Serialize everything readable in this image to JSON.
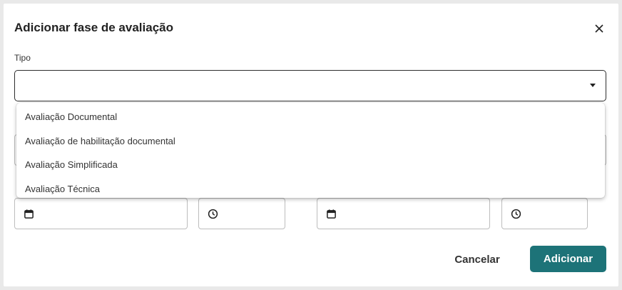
{
  "dialog": {
    "title": "Adicionar fase de avaliação",
    "close_icon": "close-icon"
  },
  "form": {
    "tipo_label": "Tipo",
    "tipo_value": "",
    "tipo_options": [
      "Avaliação Documental",
      "Avaliação de habilitação documental",
      "Avaliação Simplificada",
      "Avaliação Técnica"
    ],
    "start_date_icon": "calendar-icon",
    "start_time_icon": "clock-icon",
    "end_date_icon": "calendar-icon",
    "end_time_icon": "clock-icon"
  },
  "actions": {
    "cancel_label": "Cancelar",
    "add_label": "Adicionar"
  },
  "colors": {
    "primary": "#1d7378",
    "border_active": "#2d2d2d",
    "border": "#bdbdbd"
  }
}
